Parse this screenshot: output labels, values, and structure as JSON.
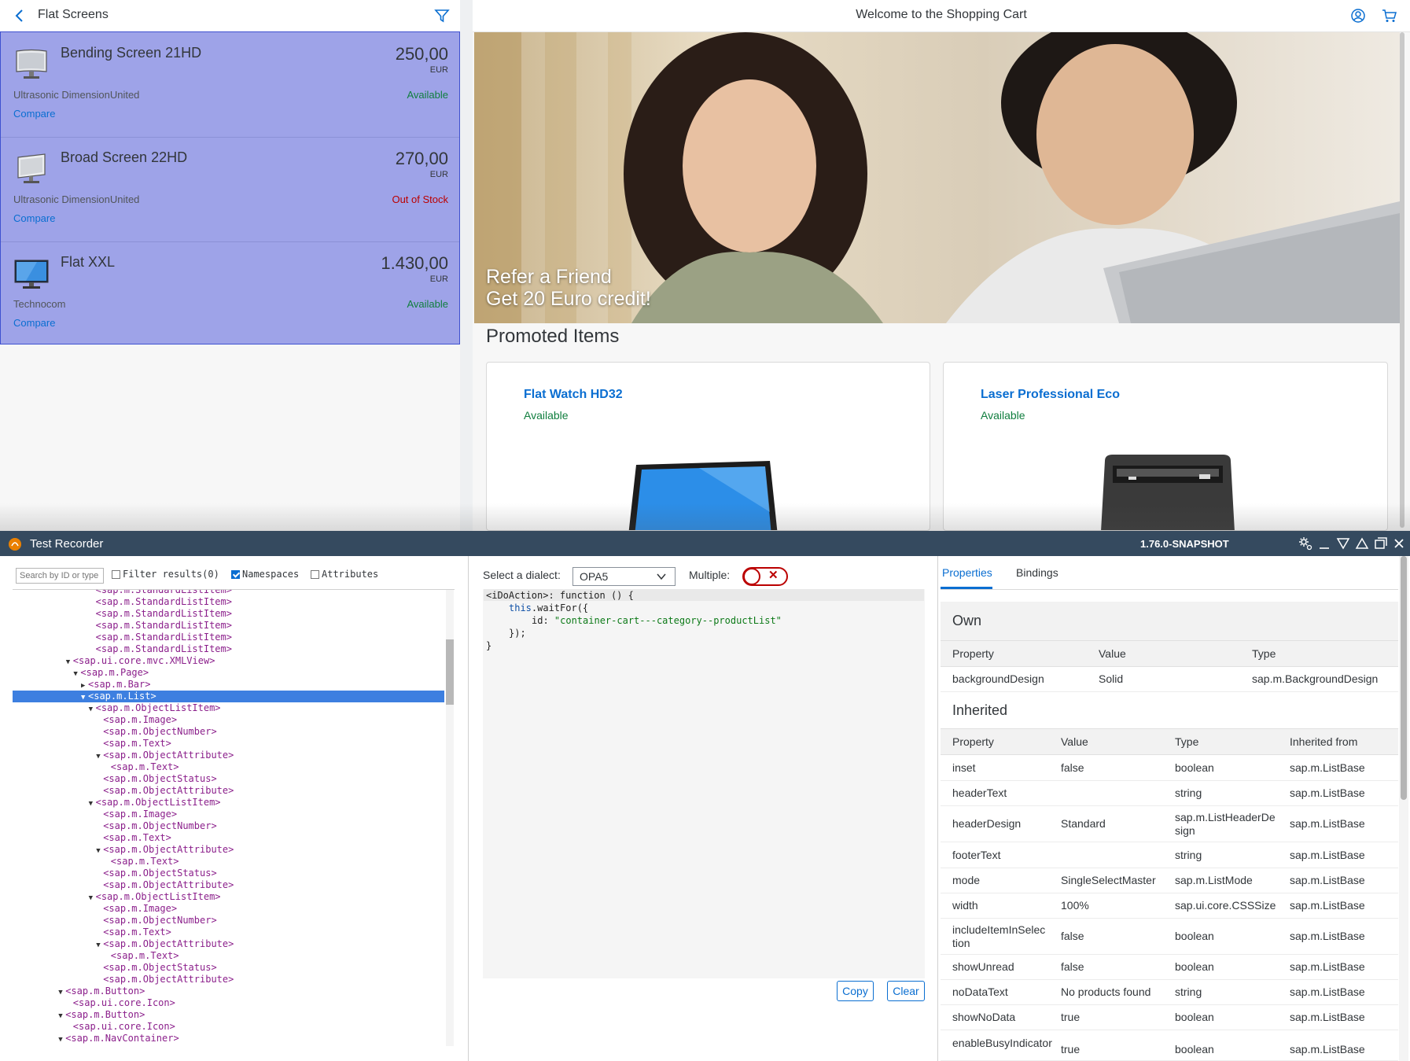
{
  "master": {
    "title": "Flat Screens",
    "items": [
      {
        "name": "Bending Screen 21HD",
        "price": "250,00",
        "currency": "EUR",
        "supplier": "Ultrasonic DimensionUnited",
        "status": "Available",
        "compare": "Compare"
      },
      {
        "name": "Broad Screen 22HD",
        "price": "270,00",
        "currency": "EUR",
        "supplier": "Ultrasonic DimensionUnited",
        "status": "Out of Stock",
        "compare": "Compare"
      },
      {
        "name": "Flat XXL",
        "price": "1.430,00",
        "currency": "EUR",
        "supplier": "Technocom",
        "status": "Available",
        "compare": "Compare"
      }
    ]
  },
  "detail": {
    "title": "Welcome to the Shopping Cart",
    "banner_line1": "Refer a Friend",
    "banner_line2": "Get 20 Euro credit!",
    "promoted_title": "Promoted Items",
    "promoted": [
      {
        "name": "Flat Watch HD32",
        "status": "Available"
      },
      {
        "name": "Laser Professional Eco",
        "status": "Available"
      }
    ]
  },
  "recorder": {
    "title": "Test Recorder",
    "version": "1.76.0-SNAPSHOT",
    "search_placeholder": "Search by ID or type",
    "filter_label": "Filter results(0)",
    "namespaces_label": "Namespaces",
    "attributes_label": "Attributes",
    "tree": [
      {
        "label": "<sap.m.StandardListItem>",
        "indent": 11,
        "tw": ""
      },
      {
        "label": "<sap.m.StandardListItem>",
        "indent": 11,
        "tw": ""
      },
      {
        "label": "<sap.m.StandardListItem>",
        "indent": 11,
        "tw": ""
      },
      {
        "label": "<sap.m.StandardListItem>",
        "indent": 11,
        "tw": ""
      },
      {
        "label": "<sap.m.StandardListItem>",
        "indent": 11,
        "tw": ""
      },
      {
        "label": "<sap.m.StandardListItem>",
        "indent": 11,
        "tw": ""
      },
      {
        "label": "<sap.ui.core.mvc.XMLView>",
        "indent": 8,
        "tw": "▼"
      },
      {
        "label": "<sap.m.Page>",
        "indent": 9,
        "tw": "▼"
      },
      {
        "label": "<sap.m.Bar>",
        "indent": 10,
        "tw": "▶"
      },
      {
        "label": "<sap.m.List>",
        "indent": 10,
        "tw": "▼",
        "selected": true
      },
      {
        "label": "<sap.m.ObjectListItem>",
        "indent": 11,
        "tw": "▼"
      },
      {
        "label": "<sap.m.Image>",
        "indent": 12,
        "tw": ""
      },
      {
        "label": "<sap.m.ObjectNumber>",
        "indent": 12,
        "tw": ""
      },
      {
        "label": "<sap.m.Text>",
        "indent": 12,
        "tw": ""
      },
      {
        "label": "<sap.m.ObjectAttribute>",
        "indent": 12,
        "tw": "▼"
      },
      {
        "label": "<sap.m.Text>",
        "indent": 13,
        "tw": ""
      },
      {
        "label": "<sap.m.ObjectStatus>",
        "indent": 12,
        "tw": ""
      },
      {
        "label": "<sap.m.ObjectAttribute>",
        "indent": 12,
        "tw": ""
      },
      {
        "label": "<sap.m.ObjectListItem>",
        "indent": 11,
        "tw": "▼"
      },
      {
        "label": "<sap.m.Image>",
        "indent": 12,
        "tw": ""
      },
      {
        "label": "<sap.m.ObjectNumber>",
        "indent": 12,
        "tw": ""
      },
      {
        "label": "<sap.m.Text>",
        "indent": 12,
        "tw": ""
      },
      {
        "label": "<sap.m.ObjectAttribute>",
        "indent": 12,
        "tw": "▼"
      },
      {
        "label": "<sap.m.Text>",
        "indent": 13,
        "tw": ""
      },
      {
        "label": "<sap.m.ObjectStatus>",
        "indent": 12,
        "tw": ""
      },
      {
        "label": "<sap.m.ObjectAttribute>",
        "indent": 12,
        "tw": ""
      },
      {
        "label": "<sap.m.ObjectListItem>",
        "indent": 11,
        "tw": "▼"
      },
      {
        "label": "<sap.m.Image>",
        "indent": 12,
        "tw": ""
      },
      {
        "label": "<sap.m.ObjectNumber>",
        "indent": 12,
        "tw": ""
      },
      {
        "label": "<sap.m.Text>",
        "indent": 12,
        "tw": ""
      },
      {
        "label": "<sap.m.ObjectAttribute>",
        "indent": 12,
        "tw": "▼"
      },
      {
        "label": "<sap.m.Text>",
        "indent": 13,
        "tw": ""
      },
      {
        "label": "<sap.m.ObjectStatus>",
        "indent": 12,
        "tw": ""
      },
      {
        "label": "<sap.m.ObjectAttribute>",
        "indent": 12,
        "tw": ""
      },
      {
        "label": "<sap.m.Button>",
        "indent": 7,
        "tw": "▼"
      },
      {
        "label": "<sap.ui.core.Icon>",
        "indent": 8,
        "tw": ""
      },
      {
        "label": "<sap.m.Button>",
        "indent": 7,
        "tw": "▼"
      },
      {
        "label": "<sap.ui.core.Icon>",
        "indent": 8,
        "tw": ""
      },
      {
        "label": "<sap.m.NavContainer>",
        "indent": 7,
        "tw": "▼"
      }
    ],
    "dialect_label": "Select a dialect:",
    "dialect_value": "OPA5",
    "multiple_label": "Multiple:",
    "code": {
      "line1": "<iDoAction>: function () {",
      "line2_fn": "this",
      "line2_rest": ".waitFor({",
      "line3_key": "id: ",
      "line3_value": "\"container-cart---category--productList\"",
      "line4": "});",
      "line5": "}"
    },
    "copy_label": "Copy",
    "clear_label": "Clear",
    "tabs": {
      "properties": "Properties",
      "bindings": "Bindings"
    },
    "own": {
      "title": "Own",
      "headers": [
        "Property",
        "Value",
        "Type"
      ],
      "rows": [
        [
          "backgroundDesign",
          "Solid",
          "sap.m.BackgroundDesign"
        ]
      ]
    },
    "inherited": {
      "title": "Inherited",
      "headers": [
        "Property",
        "Value",
        "Type",
        "Inherited from"
      ],
      "rows": [
        [
          "inset",
          "false",
          "boolean",
          "sap.m.ListBase"
        ],
        [
          "headerText",
          "",
          "string",
          "sap.m.ListBase"
        ],
        [
          "headerDesign",
          "Standard",
          "sap.m.ListHeaderDesign",
          "sap.m.ListBase"
        ],
        [
          "footerText",
          "",
          "string",
          "sap.m.ListBase"
        ],
        [
          "mode",
          "SingleSelectMaster",
          "sap.m.ListMode",
          "sap.m.ListBase"
        ],
        [
          "width",
          "100%",
          "sap.ui.core.CSSSize",
          "sap.m.ListBase"
        ],
        [
          "includeItemInSelection",
          "false",
          "boolean",
          "sap.m.ListBase"
        ],
        [
          "showUnread",
          "false",
          "boolean",
          "sap.m.ListBase"
        ],
        [
          "noDataText",
          "No products found",
          "string",
          "sap.m.ListBase"
        ],
        [
          "showNoData",
          "true",
          "boolean",
          "sap.m.ListBase"
        ],
        [
          "enableBusyIndicator",
          "true",
          "boolean",
          "sap.m.ListBase"
        ]
      ]
    }
  },
  "colors": {
    "selection": "#9ea3e8",
    "accent": "#0a6ed1",
    "positive": "#107e3e",
    "negative": "#bb0000",
    "recorder_bar": "#354a5f"
  }
}
